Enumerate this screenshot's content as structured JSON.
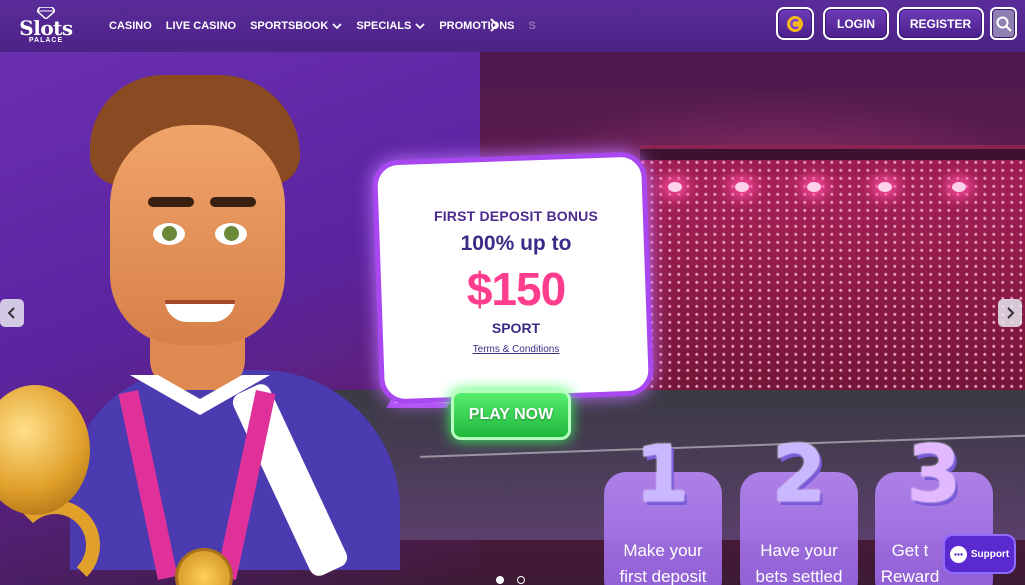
{
  "brand": {
    "logo_word": "Slots",
    "logo_sub": "PALACE"
  },
  "nav": {
    "items": [
      {
        "label": "CASINO",
        "dropdown": false
      },
      {
        "label": "LIVE CASINO",
        "dropdown": false
      },
      {
        "label": "SPORTSBOOK",
        "dropdown": true
      },
      {
        "label": "SPECIALS",
        "dropdown": true
      },
      {
        "label": "PROMOTIONS",
        "dropdown": false
      }
    ],
    "overflow_label": "S",
    "next_icon": "chevron-right-icon"
  },
  "header_actions": {
    "coin_icon": "coin-icon",
    "login_label": "LOGIN",
    "register_label": "REGISTER",
    "search_icon": "search-icon"
  },
  "promo": {
    "title": "FIRST DEPOSIT BONUS",
    "amount_prefix": "100% up to",
    "amount": "$150",
    "category": "SPORT",
    "terms_label": "Terms & Conditions",
    "cta_label": "PLAY NOW"
  },
  "steps": [
    {
      "number": "1",
      "line1": "Make your",
      "line2": "first deposit"
    },
    {
      "number": "2",
      "line1": "Have your",
      "line2": "bets settled"
    },
    {
      "number": "3",
      "line1": "Get t",
      "line2": "Reward"
    }
  ],
  "carousel": {
    "total_slides": 2,
    "active_slide": 1,
    "prev_icon": "chevron-left-icon",
    "next_icon": "chevron-right-icon"
  },
  "support": {
    "label": "Support",
    "icon": "chat-icon"
  },
  "colors": {
    "header": "#5a2c9a",
    "accent_pink": "#ff3d8e",
    "cta_green": "#2fd34f",
    "bubble_border": "#a948f0"
  }
}
